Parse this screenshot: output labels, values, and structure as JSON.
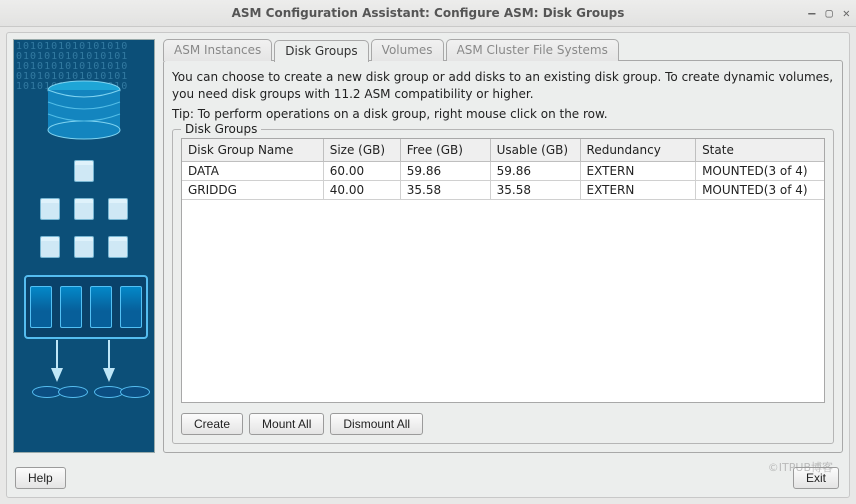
{
  "window": {
    "title": "ASM Configuration Assistant: Configure ASM: Disk Groups"
  },
  "tabs": [
    {
      "label": "ASM Instances",
      "active": false
    },
    {
      "label": "Disk Groups",
      "active": true
    },
    {
      "label": "Volumes",
      "active": false
    },
    {
      "label": "ASM Cluster File Systems",
      "active": false
    }
  ],
  "text": {
    "description": "You can choose to create a new disk group or add disks to an existing disk group. To create dynamic volumes, you need disk groups with 11.2 ASM compatibility or higher.",
    "tip": "Tip: To perform operations on a disk group, right mouse click on the row.",
    "group_title": "Disk Groups"
  },
  "table": {
    "headers": [
      "Disk Group Name",
      "Size (GB)",
      "Free (GB)",
      "Usable (GB)",
      "Redundancy",
      "State"
    ],
    "rows": [
      [
        "DATA",
        "60.00",
        "59.86",
        "59.86",
        "EXTERN",
        "MOUNTED(3 of 4)"
      ],
      [
        "GRIDDG",
        "40.00",
        "35.58",
        "35.58",
        "EXTERN",
        "MOUNTED(3 of 4)"
      ]
    ]
  },
  "buttons": {
    "create": "Create",
    "mount_all": "Mount All",
    "dismount_all": "Dismount All",
    "help": "Help",
    "exit": "Exit"
  },
  "watermark": "©ITPUB博客"
}
